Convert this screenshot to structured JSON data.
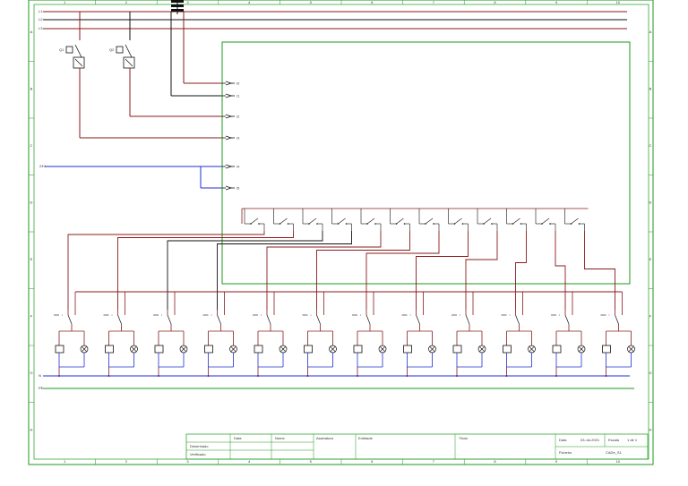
{
  "colors": {
    "frame": "#1a9a1a",
    "red": "#8b1a1a",
    "black": "#111111",
    "blue": "#1f2fd0",
    "green": "#1a9a1a"
  },
  "rails": {
    "l1": "L1",
    "l2": "L2",
    "l3": "L3",
    "neutral": "N",
    "ground": "PE",
    "dc_plus": "24V",
    "dc_minus": "0V"
  },
  "breakers": [
    {
      "tag": "Q1",
      "label": "Q1"
    },
    {
      "tag": "Q2",
      "label": "Q2"
    }
  ],
  "plc_inputs": [
    {
      "tag": "I0"
    },
    {
      "tag": "I1"
    },
    {
      "tag": "I2"
    },
    {
      "tag": "I3"
    },
    {
      "tag": "I4"
    },
    {
      "tag": "I5"
    }
  ],
  "plc_output_count": 12,
  "relay_count": 12,
  "title_block": {
    "data_hdr": "Data",
    "nome_hdr": "Nome",
    "assinatura_hdr": "Assinatura",
    "entidade_hdr": "Entidade",
    "titulo_hdr": "Título",
    "desenhado": "Desenhado",
    "verificado": "Verificado",
    "data_lbl": "Data",
    "date_value": "03-Jul-2021",
    "escala_lbl": "Escala",
    "sheet_value": "1 de 1",
    "ficheiro_lbl": "Ficheiro",
    "file_value": "CADe_S1"
  },
  "grid_cols": [
    "1",
    "2",
    "3",
    "4",
    "5",
    "6",
    "7",
    "8",
    "9",
    "10"
  ],
  "grid_rows": [
    "A",
    "B",
    "C",
    "D",
    "E",
    "F",
    "G",
    "H"
  ]
}
